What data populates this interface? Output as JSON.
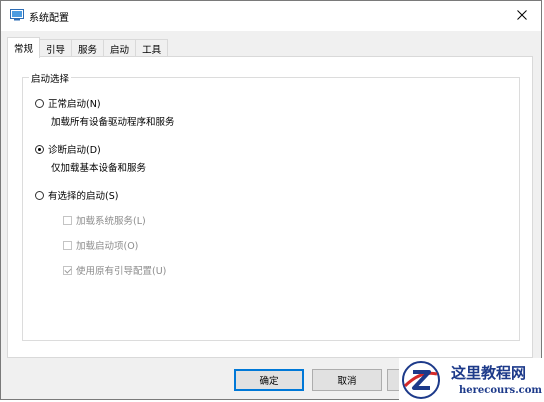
{
  "window": {
    "title": "系统配置",
    "close_glyph": "✕"
  },
  "tabs": [
    {
      "label": "常规",
      "active": true
    },
    {
      "label": "引导",
      "active": false
    },
    {
      "label": "服务",
      "active": false
    },
    {
      "label": "启动",
      "active": false
    },
    {
      "label": "工具",
      "active": false
    }
  ],
  "general": {
    "group_title": "启动选择",
    "normal": {
      "label": "正常启动(N)",
      "desc": "加载所有设备驱动程序和服务",
      "selected": false
    },
    "diagnostic": {
      "label": "诊断启动(D)",
      "desc": "仅加载基本设备和服务",
      "selected": true
    },
    "selective": {
      "label": "有选择的启动(S)",
      "selected": false,
      "options": [
        {
          "label": "加载系统服务(L)",
          "checked": false,
          "enabled": false
        },
        {
          "label": "加载启动项(O)",
          "checked": false,
          "enabled": false
        },
        {
          "label": "使用原有引导配置(U)",
          "checked": true,
          "enabled": false
        }
      ]
    }
  },
  "buttons": {
    "ok": "确定",
    "cancel": "取消"
  },
  "watermark": {
    "title": "这里教程网",
    "url": "herecours.com",
    "accent": "#1d3a8a",
    "icon": "z-logo"
  }
}
